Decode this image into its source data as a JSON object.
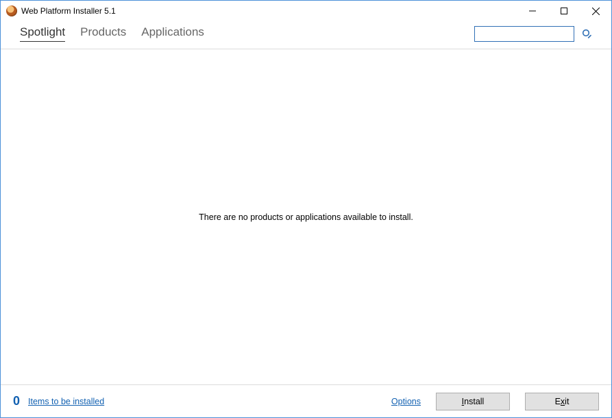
{
  "window": {
    "title": "Web Platform Installer 5.1"
  },
  "tabs": {
    "spotlight": "Spotlight",
    "products": "Products",
    "applications": "Applications"
  },
  "search": {
    "value": "",
    "placeholder": ""
  },
  "main": {
    "empty_message": "There are no products or applications available to install."
  },
  "footer": {
    "install_count": "0",
    "items_link": "Items to be installed",
    "options_link": "Options",
    "install_prefix": "I",
    "install_rest": "nstall",
    "exit_prefix": "E",
    "exit_rest": "xit"
  }
}
